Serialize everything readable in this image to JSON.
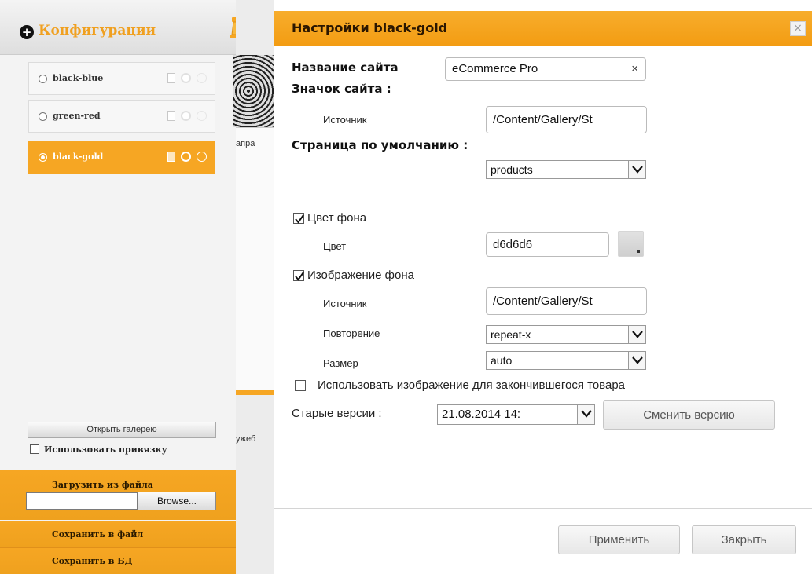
{
  "sidebar": {
    "title": "Конфигурации",
    "configs": [
      {
        "label": "black-blue",
        "selected": false
      },
      {
        "label": "green-red",
        "selected": false
      },
      {
        "label": "black-gold",
        "selected": true
      }
    ],
    "open_gallery_label": "Открыть галерею",
    "use_binding_label": "Использовать привязку",
    "use_binding_checked": false,
    "upload_label": "Загрузить из файла",
    "browse_label": "Browse...",
    "save_file_label": "Сохранить в файл",
    "save_db_label": "Сохранить в БД",
    "accent_color": "#f6a623"
  },
  "background_peek": {
    "text_1": "апра",
    "text_2": "ужеб"
  },
  "dialog": {
    "title": "Настройки black-gold",
    "close_symbol": "×",
    "site_name_label": "Название сайта",
    "site_name_value": "eCommerce Pro",
    "clear_symbol": "×",
    "site_icon_label": "Значок сайта :",
    "icon_source_label": "Источник",
    "icon_source_value": "/Content/Gallery/St",
    "default_page_label": "Страница по умолчанию :",
    "default_page_value": "products",
    "bg_color_checkbox_label": "Цвет фона",
    "bg_color_checked": true,
    "color_label": "Цвет",
    "color_value": "d6d6d6",
    "bg_image_checkbox_label": "Изображение фона",
    "bg_image_checked": true,
    "bg_source_label": "Источник",
    "bg_source_value": "/Content/Gallery/St",
    "repeat_label": "Повторение",
    "repeat_value": "repeat-x",
    "size_label": "Размер",
    "size_value": "auto",
    "sold_out_label": "Использовать изображение для закончившегося товара",
    "sold_out_checked": false,
    "old_versions_label": "Старые версии :",
    "old_version_value": "21.08.2014 14:",
    "change_version_label": "Сменить версию",
    "apply_label": "Применить",
    "close_label": "Закрыть"
  }
}
